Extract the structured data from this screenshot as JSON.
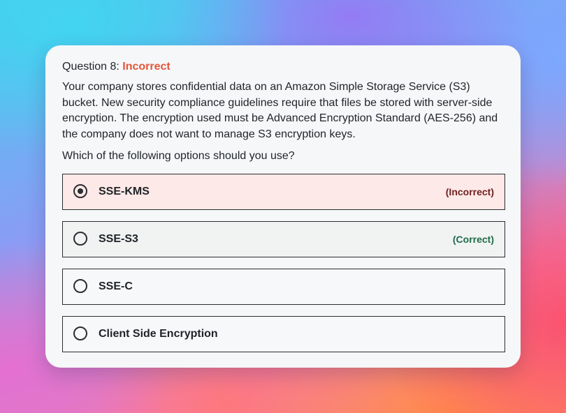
{
  "question": {
    "number_label": "Question 8:",
    "status": "Incorrect",
    "body": "Your company stores confidential data on an Amazon Simple Storage Service (S3) bucket. New security compliance guidelines require that files be stored with server-side encryption. The encryption used must be Advanced Encryption Standard (AES-256) and the company does not want to manage S3 encryption keys.",
    "prompt": "Which of the following options should you use?"
  },
  "options": [
    {
      "label": "SSE-KMS",
      "tag": "(Incorrect)",
      "selected": true,
      "state": "incorrect"
    },
    {
      "label": "SSE-S3",
      "tag": "(Correct)",
      "selected": false,
      "state": "correct"
    },
    {
      "label": "SSE-C",
      "tag": "",
      "selected": false,
      "state": "neutral"
    },
    {
      "label": "Client Side Encryption",
      "tag": "",
      "selected": false,
      "state": "neutral"
    }
  ],
  "colors": {
    "status_incorrect": "#e4573a",
    "incorrect_bg": "#fde9e7",
    "correct_bg": "#f0f3f2",
    "incorrect_tag": "#6e1f1f",
    "correct_tag": "#1f6a4a"
  }
}
